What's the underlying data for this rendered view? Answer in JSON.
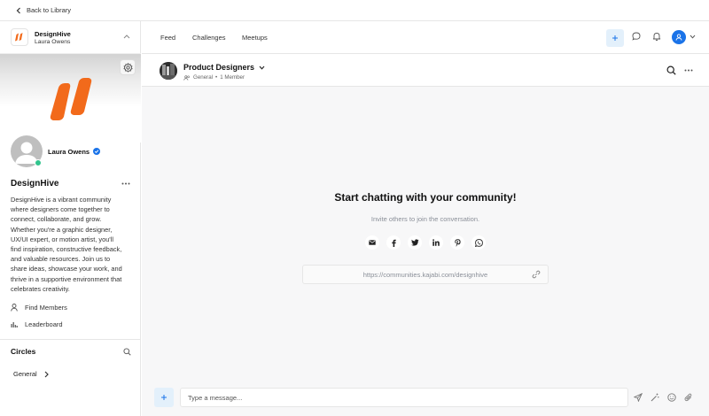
{
  "topbar": {
    "back_label": "Back to Library"
  },
  "sidebar": {
    "community_name": "DesignHive",
    "owner_name": "Laura Owens",
    "profile_name": "Laura Owens",
    "title": "DesignHive",
    "description": "DesignHive is a vibrant community where designers come together to connect, collaborate, and grow. Whether you're a graphic designer, UX/UI expert, or motion artist, you'll find inspiration, constructive feedback, and valuable resources. Join us to share ideas, showcase your work, and thrive in a supportive environment that celebrates creativity.",
    "links": [
      {
        "label": "Find Members",
        "icon": "person-icon"
      },
      {
        "label": "Leaderboard",
        "icon": "bar-chart-icon"
      }
    ],
    "circles_title": "Circles",
    "circles": [
      {
        "label": "General"
      }
    ]
  },
  "nav": {
    "tabs": [
      "Feed",
      "Challenges",
      "Meetups"
    ]
  },
  "channel": {
    "name": "Product Designers",
    "circle": "General",
    "members": "1 Member"
  },
  "empty_state": {
    "title": "Start chatting with your community!",
    "subtitle": "Invite others to join the conversation.",
    "share_icons": [
      "email-icon",
      "facebook-icon",
      "twitter-icon",
      "linkedin-icon",
      "pinterest-icon",
      "whatsapp-icon"
    ],
    "invite_link": "https://communities.kajabi.com/designhive"
  },
  "composer": {
    "placeholder": "Type a message..."
  },
  "colors": {
    "accent": "#1a73e8",
    "brand_orange": "#f26a1b",
    "online": "#31c48d",
    "accent_light": "#e3f0fb"
  }
}
